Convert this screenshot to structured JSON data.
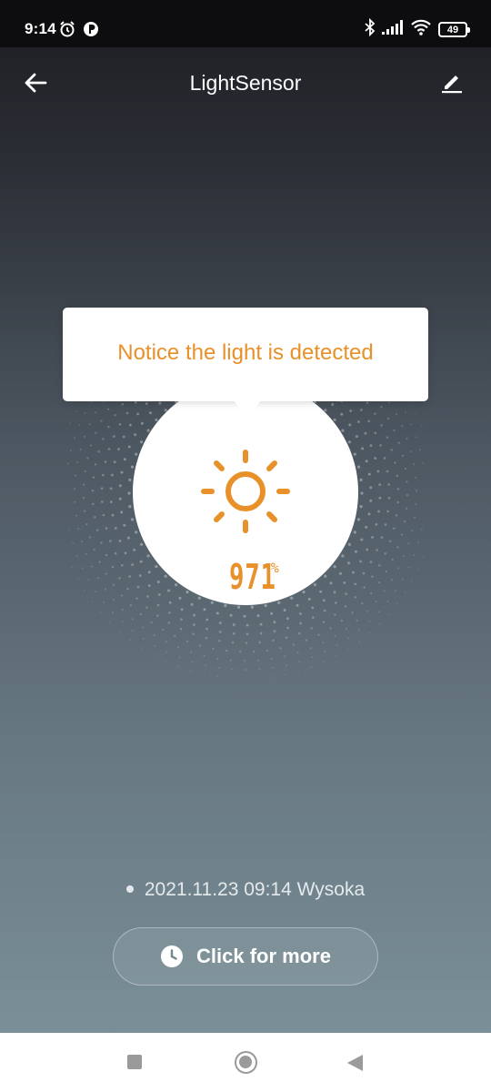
{
  "status_bar": {
    "time": "9:14",
    "battery": "49",
    "icons": [
      "alarm-icon",
      "app-notification-icon",
      "bluetooth-icon",
      "signal-icon",
      "wifi-icon",
      "battery-icon"
    ]
  },
  "header": {
    "title": "LightSensor",
    "back_icon": "arrow-left-icon",
    "edit_icon": "pencil-icon"
  },
  "tooltip": {
    "text": "Notice the light is detected"
  },
  "sensor": {
    "value": "971",
    "unit": "%",
    "icon": "sun-icon",
    "accent_color": "#e8902a"
  },
  "log": {
    "entry": "2021.11.23 09:14 Wysoka"
  },
  "more_button": {
    "label": "Click for more",
    "icon": "clock-icon"
  },
  "nav_bar": {
    "items": [
      "recent-apps-button",
      "home-button",
      "back-button"
    ]
  }
}
